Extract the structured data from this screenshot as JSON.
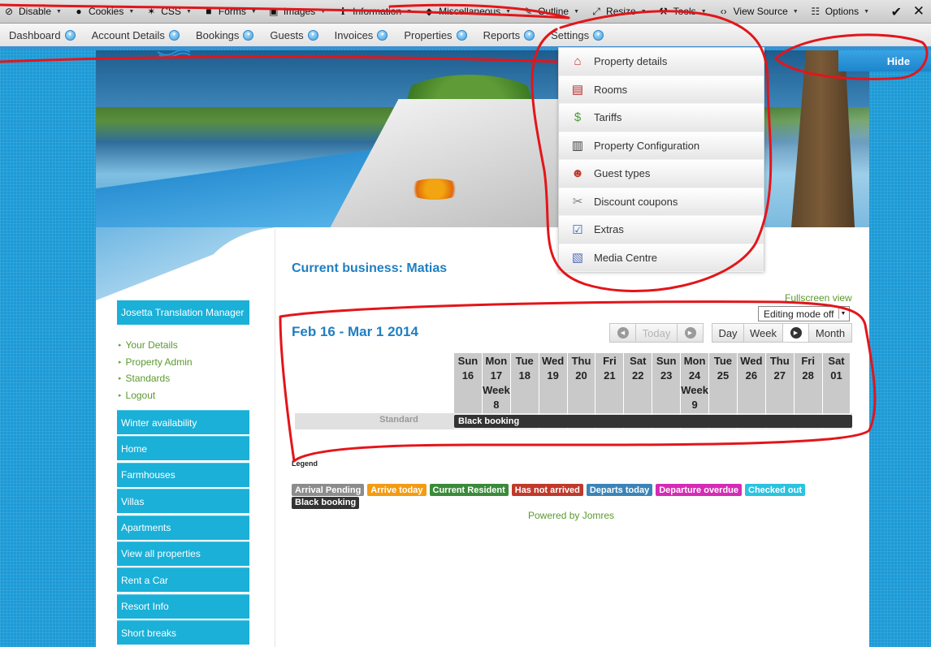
{
  "devtoolbar": {
    "items": [
      {
        "label": "Disable",
        "icon": "disable-icon"
      },
      {
        "label": "Cookies",
        "icon": "user-icon"
      },
      {
        "label": "CSS",
        "icon": "wand-icon"
      },
      {
        "label": "Forms",
        "icon": "form-icon"
      },
      {
        "label": "Images",
        "icon": "image-icon"
      },
      {
        "label": "Information",
        "icon": "info-icon"
      },
      {
        "label": "Miscellaneous",
        "icon": "cube-icon"
      },
      {
        "label": "Outline",
        "icon": "pencil-icon"
      },
      {
        "label": "Resize",
        "icon": "resize-icon"
      },
      {
        "label": "Tools",
        "icon": "wrench-icon"
      },
      {
        "label": "View Source",
        "icon": "code-icon"
      },
      {
        "label": "Options",
        "icon": "options-icon"
      }
    ]
  },
  "menubar": {
    "items": [
      "Dashboard",
      "Account Details",
      "Bookings",
      "Guests",
      "Invoices",
      "Properties",
      "Reports",
      "Settings"
    ]
  },
  "settings_menu": {
    "items": [
      {
        "label": "Property details",
        "icon": "house-icon",
        "color": "#c8332b"
      },
      {
        "label": "Rooms",
        "icon": "rooms-icon",
        "color": "#b52a2a"
      },
      {
        "label": "Tariffs",
        "icon": "money-icon",
        "color": "#4c9a3a"
      },
      {
        "label": "Property Configuration",
        "icon": "config-icon",
        "color": "#3b3b3b"
      },
      {
        "label": "Guest types",
        "icon": "guests-icon",
        "color": "#c23a2b"
      },
      {
        "label": "Discount coupons",
        "icon": "coupon-icon",
        "color": "#7d7d7d"
      },
      {
        "label": "Extras",
        "icon": "extras-icon",
        "color": "#2d6bbd"
      },
      {
        "label": "Media Centre",
        "icon": "media-icon",
        "color": "#5670b8"
      }
    ]
  },
  "hide_label": "Hide",
  "sidebar": {
    "title": "Josetta Translation Manager",
    "user_links": [
      "Your Details",
      "Property Admin",
      "Standards",
      "Logout"
    ],
    "nav": [
      "Winter availability",
      "Home",
      "Farmhouses",
      "Villas",
      "Apartments",
      "View all properties",
      "Rent a Car",
      "Resort Info",
      "Short breaks"
    ]
  },
  "main": {
    "current_business": "Current business: Matias",
    "fullscreen": "Fullscreen view",
    "editing_mode": "Editing mode off",
    "date_range": "Feb 16 - Mar 1 2014",
    "today": "Today",
    "views": {
      "day": "Day",
      "week": "Week",
      "month": "Month"
    }
  },
  "calendar": {
    "days": [
      {
        "lines": [
          "Sun",
          "16"
        ]
      },
      {
        "lines": [
          "Mon",
          "17",
          "Week",
          "8"
        ]
      },
      {
        "lines": [
          "Tue",
          "18"
        ]
      },
      {
        "lines": [
          "Wed",
          "19"
        ]
      },
      {
        "lines": [
          "Thu",
          "20"
        ]
      },
      {
        "lines": [
          "Fri",
          "21"
        ]
      },
      {
        "lines": [
          "Sat",
          "22"
        ]
      },
      {
        "lines": [
          "Sun",
          "23"
        ]
      },
      {
        "lines": [
          "Mon",
          "24",
          "Week",
          "9"
        ]
      },
      {
        "lines": [
          "Tue",
          "25"
        ]
      },
      {
        "lines": [
          "Wed",
          "26"
        ]
      },
      {
        "lines": [
          "Thu",
          "27"
        ]
      },
      {
        "lines": [
          "Fri",
          "28"
        ]
      },
      {
        "lines": [
          "Sat",
          "01"
        ]
      }
    ],
    "room": "Standard",
    "booking": "Black booking"
  },
  "legend": {
    "title": "Legend",
    "items": [
      {
        "label": "Arrival Pending",
        "color": "#8c8c8c"
      },
      {
        "label": "Arrive today",
        "color": "#f39c12"
      },
      {
        "label": "Current Resident",
        "color": "#3a8a3a"
      },
      {
        "label": "Has not arrived",
        "color": "#c0392b"
      },
      {
        "label": "Departs today",
        "color": "#3b84b8"
      },
      {
        "label": "Departure overdue",
        "color": "#d52bb5"
      },
      {
        "label": "Checked out",
        "color": "#2ac3e0"
      },
      {
        "label": "Black booking",
        "color": "#333333"
      }
    ]
  },
  "powered_by": "Powered by Jomres",
  "colors": {
    "accent": "#1f7fc1",
    "sidebar": "#1ab0d8",
    "link": "#5a9a2e",
    "annotation": "#e3151a"
  }
}
